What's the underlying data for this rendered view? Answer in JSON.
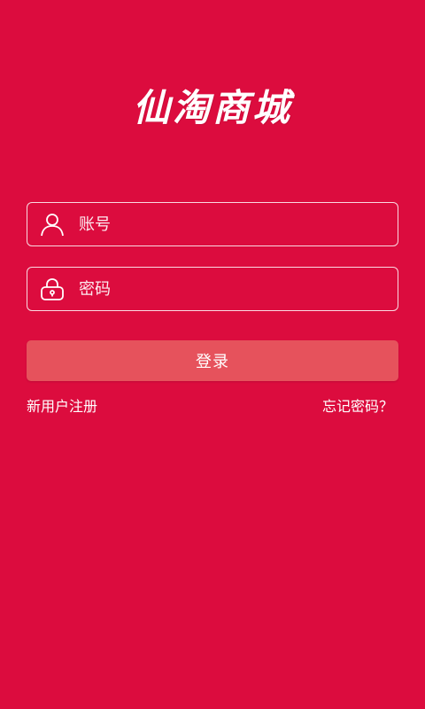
{
  "app": {
    "title": "仙淘商城"
  },
  "login_form": {
    "account_placeholder": "账号",
    "password_placeholder": "密码",
    "submit_label": "登录"
  },
  "links": {
    "register": "新用户注册",
    "forgot_password": "忘记密码？"
  },
  "icons": {
    "account": "user-icon",
    "password": "lock-icon"
  },
  "colors": {
    "background": "#dc0c3e",
    "button": "#e6525c",
    "text": "#ffffff"
  }
}
